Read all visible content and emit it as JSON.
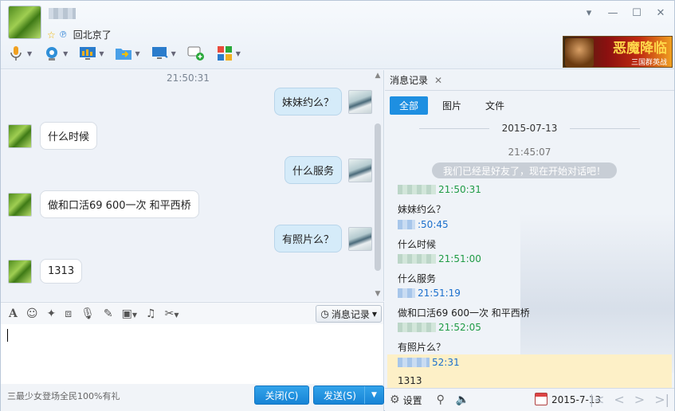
{
  "header": {
    "status_text": "回北京了",
    "window_controls": [
      "▾",
      "—",
      "☐",
      "✕"
    ],
    "ad_banner": {
      "title": "恶魔降临",
      "subtitle": "三国群英战"
    }
  },
  "chat": {
    "timestamp": "21:50:31",
    "messages": [
      {
        "side": "right",
        "text": "妹妹约么？"
      },
      {
        "side": "left",
        "text": "什么时候"
      },
      {
        "side": "right",
        "text": "什么服务"
      },
      {
        "side": "left",
        "text": "做和口活69 600一次 和平西桥"
      },
      {
        "side": "right",
        "text": "有照片么？"
      },
      {
        "side": "left",
        "text": "1313"
      }
    ]
  },
  "input_toolbar": {
    "history_label": "消息记录"
  },
  "bottom": {
    "ad_text": "三最少女登场全民100%有礼",
    "close_label": "关闭(C)",
    "send_label": "发送(S)"
  },
  "history": {
    "tab_label": "消息记录",
    "filters": [
      "全部",
      "图片",
      "文件"
    ],
    "date": "2015-07-13",
    "center_time": "21:45:07",
    "notice": "我们已经是好友了，现在开始对话吧！",
    "entries": [
      {
        "who": "other",
        "time": "21:50:31",
        "text": "妹妹约么？"
      },
      {
        "who": "me",
        "time": ":50:45",
        "text": "什么时候"
      },
      {
        "who": "other",
        "time": "21:51:00",
        "text": "什么服务"
      },
      {
        "who": "me",
        "time": "21:51:19",
        "text": "做和口活69 600一次 和平西桥"
      },
      {
        "who": "other",
        "time": "21:52:05",
        "text": "有照片么？"
      },
      {
        "who": "me",
        "time": "52:31",
        "text": "1313"
      }
    ],
    "settings_label": "设置",
    "bottom_date": "2015-7-13"
  }
}
